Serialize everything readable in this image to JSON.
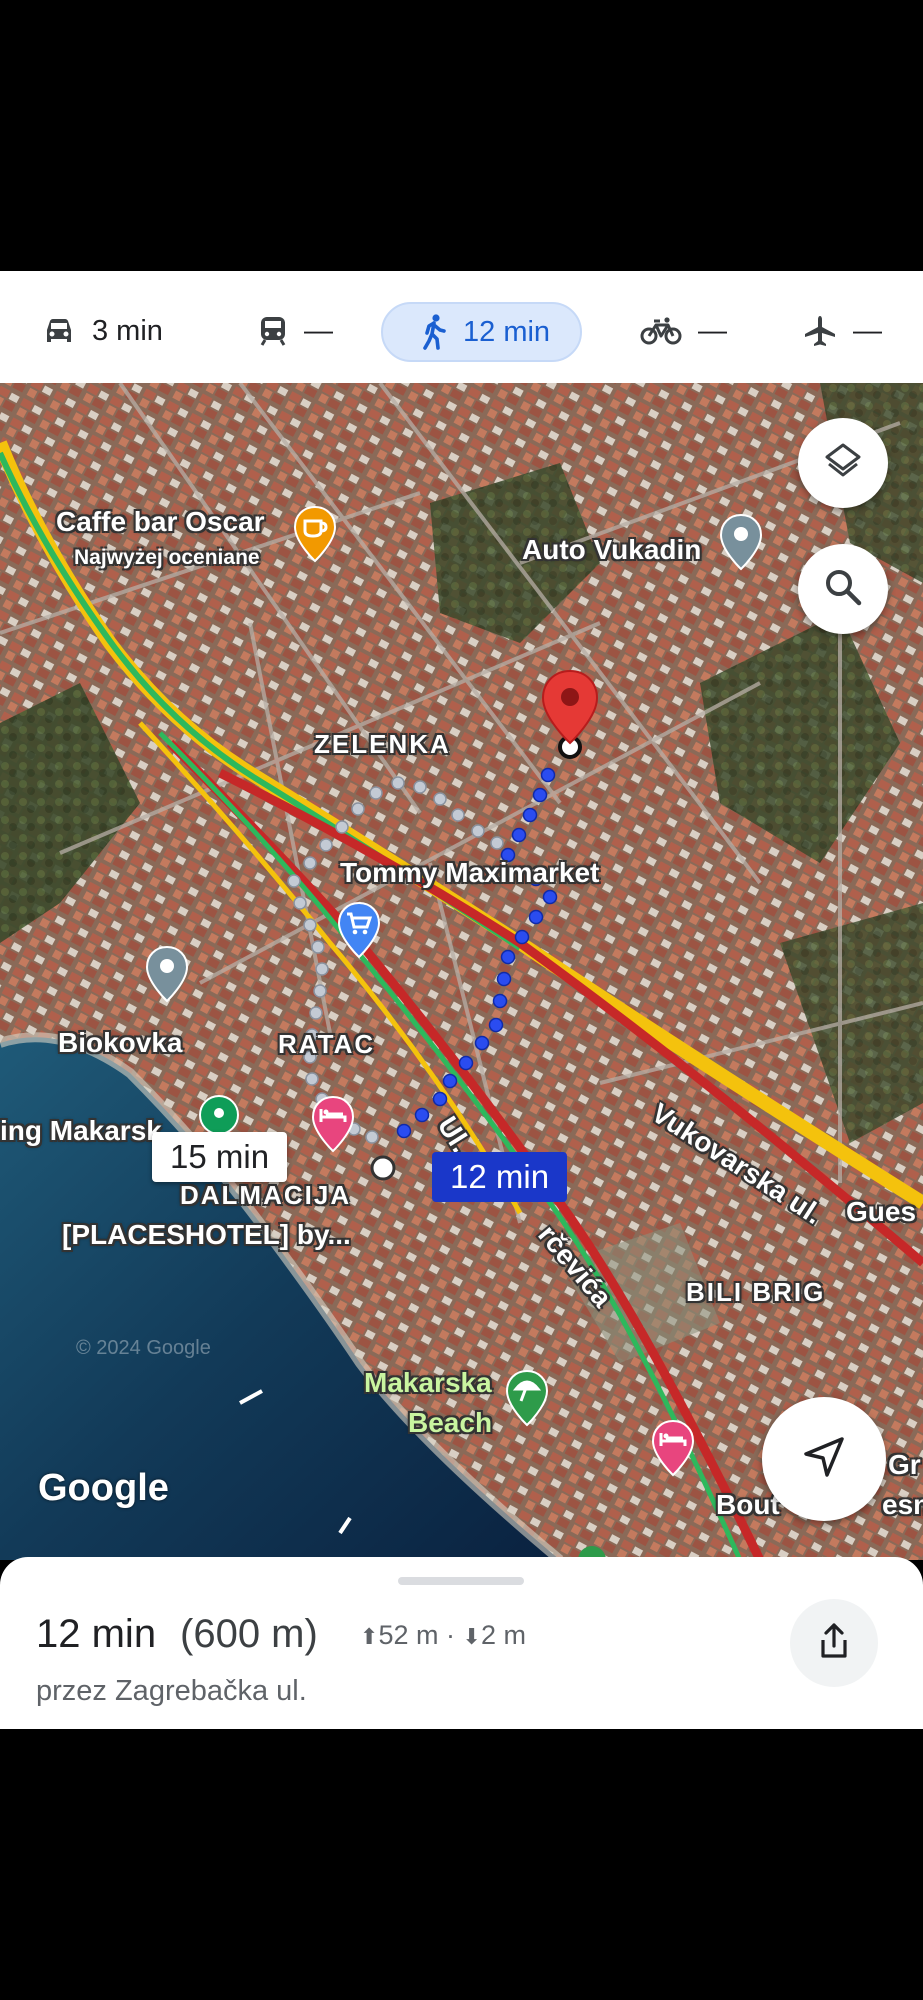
{
  "modes": [
    {
      "name": "car",
      "label": "3 min",
      "active": false
    },
    {
      "name": "transit",
      "label": "—",
      "active": false
    },
    {
      "name": "walk",
      "label": "12 min",
      "active": true
    },
    {
      "name": "bike",
      "label": "—",
      "active": false
    },
    {
      "name": "flight",
      "label": "—",
      "active": false
    }
  ],
  "map": {
    "labels": {
      "caffe_bar": "Caffe bar Oscar",
      "caffe_bar_sub": "Najwyżej oceniane",
      "auto_vukadin": "Auto Vukadin",
      "zelenka": "ZELENKA",
      "tommy": "Tommy Maximarket",
      "biokovka": "Biokovka",
      "ratac": "RATAC",
      "camping": "ing Makarsk",
      "dalmacija": "DALMACIJA",
      "placeshotel": "[PLACESHOTEL] by...",
      "ul_a": "Ul. A",
      "urcevica": "rčevića",
      "vukovarska": "Vukovarska ul.",
      "gues": "Gues",
      "bili_brig": "BILI BRIG",
      "makarska_beach_1": "Makarska",
      "makarska_beach_2": "Beach",
      "gr": "Gr",
      "boutique": "Bout",
      "boutique_end": "esn",
      "copyright": "© 2024 Google"
    },
    "route_alt_time": "15 min",
    "route_main_time": "12 min",
    "logo": "Google",
    "icons": [
      "layers-icon",
      "search-icon",
      "my-location-icon"
    ]
  },
  "sheet": {
    "duration": "12 min",
    "distance": "(600 m)",
    "elevation_up": "52 m",
    "elevation_down": "2 m",
    "separator": "·",
    "via": "przez Zagrebačka ul."
  },
  "colors": {
    "accent": "#1a5fd1",
    "route": "#1a37c9",
    "destination_pin": "#e53935",
    "traffic_red": "#c62828",
    "traffic_yellow": "#f4c20d",
    "traffic_green": "#2eb85c"
  }
}
